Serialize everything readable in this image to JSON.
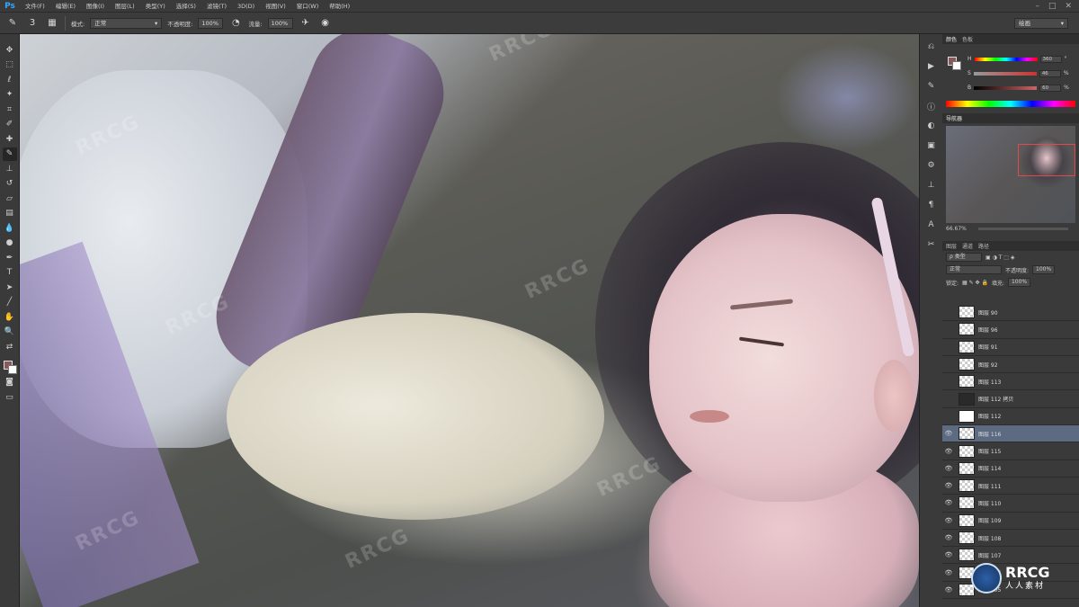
{
  "app": {
    "logo": "Ps"
  },
  "menu": [
    "文件(F)",
    "编辑(E)",
    "图像(I)",
    "图层(L)",
    "类型(Y)",
    "选择(S)",
    "滤镜(T)",
    "3D(D)",
    "视图(V)",
    "窗口(W)",
    "帮助(H)"
  ],
  "window_controls": [
    "–",
    "□",
    "✕"
  ],
  "options": {
    "brush_size": "3",
    "mode_label": "模式:",
    "mode_value": "正常",
    "opacity_label": "不透明度:",
    "opacity_value": "100%",
    "flow_label": "流量:",
    "flow_value": "100%",
    "workspace": "绘画"
  },
  "colors": {
    "foreground": "#8a5a5a",
    "background": "#ffffff",
    "accent": "#5c6b82"
  },
  "color_panel": {
    "tabs": [
      "颜色",
      "色板"
    ],
    "rows": [
      {
        "label": "H",
        "value": "360",
        "unit": "°"
      },
      {
        "label": "S",
        "value": "46",
        "unit": "%"
      },
      {
        "label": "B",
        "value": "60",
        "unit": "%"
      }
    ]
  },
  "navigator": {
    "tab": "导航器",
    "zoom": "66.67%"
  },
  "layers_panel": {
    "tabs": [
      "图层",
      "通道",
      "路径"
    ],
    "filter": "ρ 类型",
    "blend_mode": "正常",
    "opacity_label": "不透明度:",
    "opacity_value": "100%",
    "lock_label": "锁定:",
    "fill_label": "填充:",
    "fill_value": "100%",
    "layers": [
      {
        "name": "图层 90",
        "visible": false,
        "thumb": "transparent"
      },
      {
        "name": "图层 96",
        "visible": false,
        "thumb": "transparent"
      },
      {
        "name": "图层 91",
        "visible": false,
        "thumb": "transparent"
      },
      {
        "name": "图层 92",
        "visible": false,
        "thumb": "transparent"
      },
      {
        "name": "图层 113",
        "visible": false,
        "thumb": "transparent"
      },
      {
        "name": "图层 112 拷贝",
        "visible": false,
        "thumb": "dark"
      },
      {
        "name": "图层 112",
        "visible": false,
        "thumb": "white"
      },
      {
        "name": "图层 116",
        "visible": true,
        "thumb": "transparent",
        "selected": true
      },
      {
        "name": "图层 115",
        "visible": true,
        "thumb": "transparent"
      },
      {
        "name": "图层 114",
        "visible": true,
        "thumb": "transparent"
      },
      {
        "name": "图层 111",
        "visible": true,
        "thumb": "transparent"
      },
      {
        "name": "图层 110",
        "visible": true,
        "thumb": "transparent"
      },
      {
        "name": "图层 109",
        "visible": true,
        "thumb": "transparent"
      },
      {
        "name": "图层 108",
        "visible": true,
        "thumb": "transparent"
      },
      {
        "name": "图层 107",
        "visible": true,
        "thumb": "transparent"
      },
      {
        "name": "图层 106",
        "visible": true,
        "thumb": "transparent"
      },
      {
        "name": "图层 105",
        "visible": true,
        "thumb": "transparent"
      }
    ]
  },
  "watermark": {
    "text": "RRCG",
    "logo_text": "RRCG",
    "logo_sub": "人人素材"
  }
}
